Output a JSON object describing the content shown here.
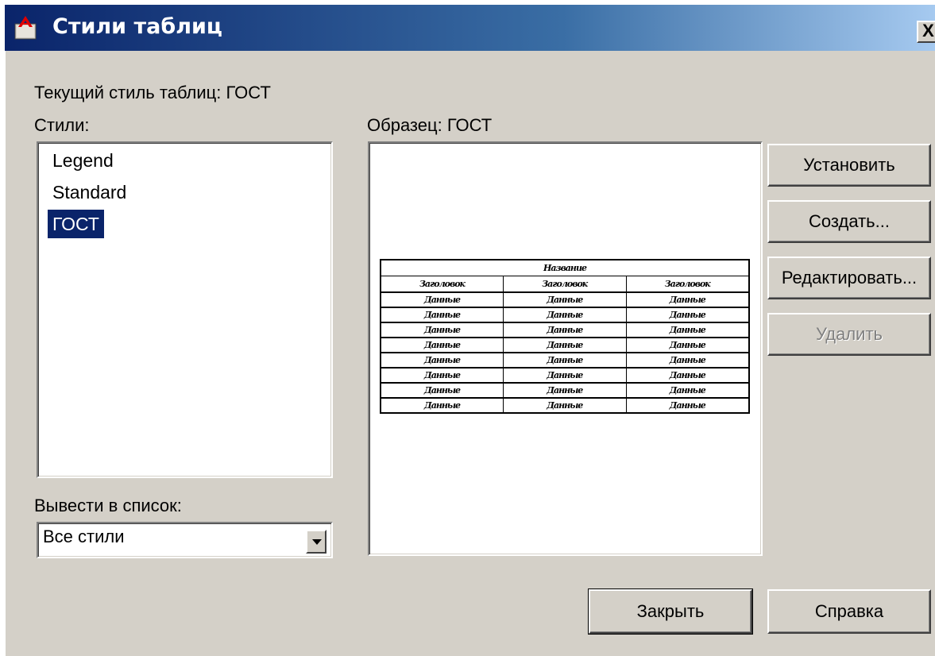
{
  "window": {
    "title": "Стили таблиц",
    "close_label": "X"
  },
  "current_style": "Текущий стиль таблиц: ГОСТ",
  "styles_label": "Стили:",
  "styles": [
    "Legend",
    "Standard",
    "ГОСТ"
  ],
  "selected_style": "ГОСТ",
  "filter": {
    "label": "Вывести в список:",
    "value": "Все стили"
  },
  "preview": {
    "label": "Образец: ГОСТ",
    "table": {
      "title": "Название",
      "headers": [
        "Заголовок",
        "Заголовок",
        "Заголовок"
      ],
      "rows": [
        [
          "Данные",
          "Данные",
          "Данные"
        ],
        [
          "Данные",
          "Данные",
          "Данные"
        ],
        [
          "Данные",
          "Данные",
          "Данные"
        ],
        [
          "Данные",
          "Данные",
          "Данные"
        ],
        [
          "Данные",
          "Данные",
          "Данные"
        ],
        [
          "Данные",
          "Данные",
          "Данные"
        ],
        [
          "Данные",
          "Данные",
          "Данные"
        ],
        [
          "Данные",
          "Данные",
          "Данные"
        ]
      ]
    }
  },
  "buttons": {
    "set_current": "Установить",
    "new": "Создать...",
    "modify": "Редактировать...",
    "delete": "Удалить",
    "close": "Закрыть",
    "help": "Справка"
  },
  "colors": {
    "titlebar_start": "#0a246a",
    "titlebar_end": "#a6caf0",
    "dialog_bg": "#d4d0c8",
    "selection": "#0a246a"
  }
}
